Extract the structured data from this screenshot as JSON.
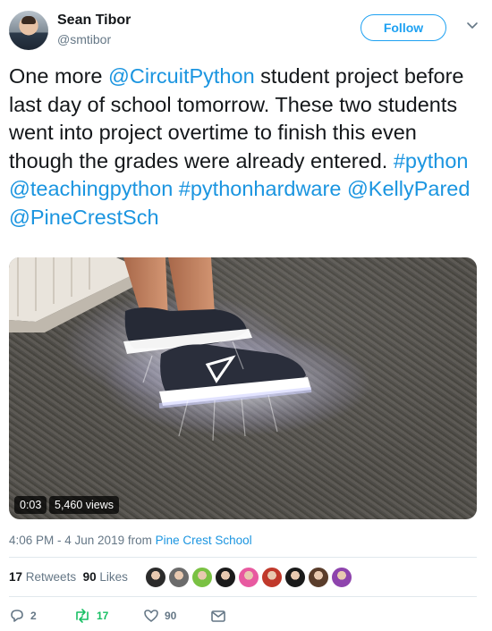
{
  "author": {
    "name": "Sean Tibor",
    "handle": "@smtibor",
    "follow_label": "Follow"
  },
  "tweet": {
    "segments": [
      {
        "text": "One more ",
        "link": false
      },
      {
        "text": "@CircuitPython",
        "link": true
      },
      {
        "text": " student project before last day of school tomorrow. These two students went into project overtime to finish this even though the grades were already entered. ",
        "link": false
      },
      {
        "text": "#python",
        "link": true
      },
      {
        "text": " ",
        "link": false
      },
      {
        "text": "@teachingpython",
        "link": true
      },
      {
        "text": " ",
        "link": false
      },
      {
        "text": "#pythonhardware",
        "link": true
      },
      {
        "text": " ",
        "link": false
      },
      {
        "text": "@KellyPared",
        "link": true
      },
      {
        "text": " ",
        "link": false
      },
      {
        "text": "@PineCrestSch",
        "link": true
      }
    ]
  },
  "video": {
    "timestamp": "0:03",
    "views": "5,460 views"
  },
  "meta": {
    "time": "4:06 PM - 4 Jun 2019 from ",
    "source": "Pine Crest School"
  },
  "stats": {
    "retweets_count": "17",
    "retweets_label": "Retweets",
    "likes_count": "90",
    "likes_label": "Likes"
  },
  "liker_avatar_colors": [
    "#2b2b2b",
    "#6b6b6b",
    "#7ac143",
    "#1b1b1b",
    "#e85aa0",
    "#c0392b",
    "#1a1a1a",
    "#5a3d2b",
    "#8e44ad"
  ],
  "actions": {
    "reply_count": "2",
    "retweet_count": "17",
    "like_count": "90",
    "accent": "#17bf63"
  }
}
